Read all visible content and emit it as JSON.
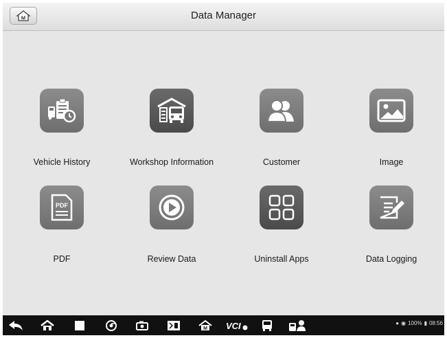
{
  "header": {
    "title": "Data Manager",
    "home_icon": "home-M-icon"
  },
  "apps": [
    {
      "label": "Vehicle History",
      "icon": "vehicle-history-icon"
    },
    {
      "label": "Workshop Information",
      "icon": "workshop-icon"
    },
    {
      "label": "Customer",
      "icon": "customer-icon"
    },
    {
      "label": "Image",
      "icon": "image-icon"
    },
    {
      "label": "PDF",
      "icon": "pdf-icon",
      "icon_text": "PDF"
    },
    {
      "label": "Review Data",
      "icon": "play-icon"
    },
    {
      "label": "Uninstall Apps",
      "icon": "apps-grid-icon"
    },
    {
      "label": "Data Logging",
      "icon": "edit-note-icon"
    }
  ],
  "navbar": {
    "home_letter": "M",
    "vci_text": "VCI",
    "status": {
      "battery": "100%",
      "time": "08:56"
    }
  }
}
